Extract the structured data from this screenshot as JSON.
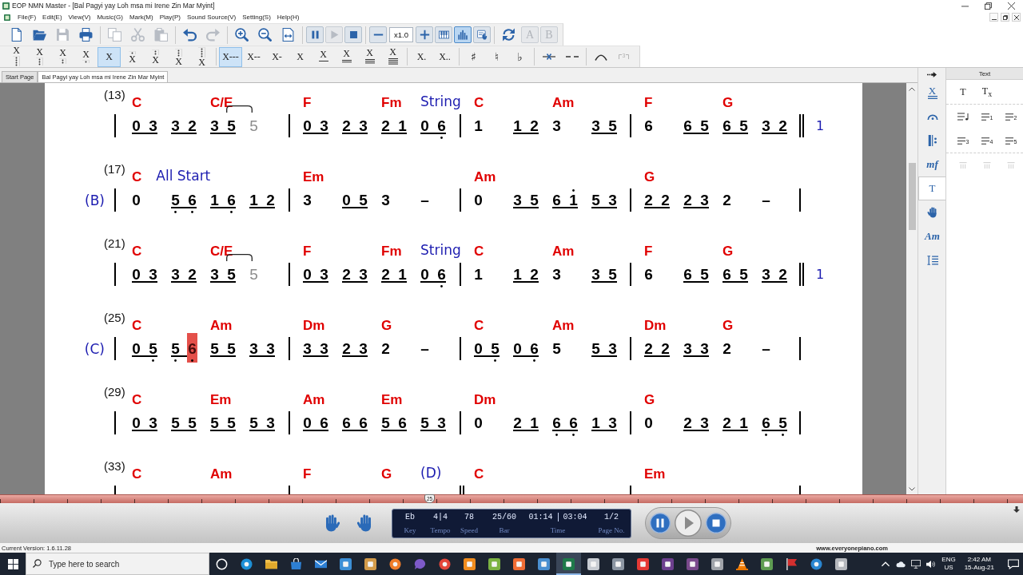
{
  "window": {
    "title": "EOP NMN Master - [Bal Pagyi yay Loh msa mi Irene Zin Mar Myint]"
  },
  "menu": [
    "File(F)",
    "Edit(E)",
    "View(V)",
    "Music(G)",
    "Mark(M)",
    "Play(P)",
    "Sound Source(V)",
    "Setting(S)",
    "Help(H)"
  ],
  "toolbar": {
    "groups": [
      [
        {
          "kind": "new",
          "disabled": false,
          "selected": false
        },
        {
          "kind": "open",
          "disabled": false,
          "selected": false
        },
        {
          "kind": "save",
          "disabled": true,
          "selected": false
        },
        {
          "kind": "print",
          "disabled": false,
          "selected": false
        }
      ],
      [
        {
          "kind": "copy",
          "disabled": true,
          "selected": false
        },
        {
          "kind": "cut",
          "disabled": true,
          "selected": false
        },
        {
          "kind": "paste",
          "disabled": true,
          "selected": false
        }
      ],
      [
        {
          "kind": "undo",
          "disabled": false,
          "selected": false
        },
        {
          "kind": "redo",
          "disabled": true,
          "selected": false
        }
      ],
      [
        {
          "kind": "zoom-in",
          "disabled": false,
          "selected": false
        },
        {
          "kind": "zoom-out",
          "disabled": false,
          "selected": false
        },
        {
          "kind": "fit",
          "disabled": false,
          "selected": false
        }
      ],
      [
        {
          "kind": "pause",
          "disabled": false,
          "selected": false
        },
        {
          "kind": "play",
          "disabled": true,
          "selected": false
        },
        {
          "kind": "stop",
          "disabled": false,
          "selected": false
        }
      ],
      [
        {
          "kind": "minus",
          "disabled": false,
          "selected": false
        },
        {
          "kind": "field",
          "value": "x1.0",
          "disabled": false,
          "selected": false
        },
        {
          "kind": "plus",
          "disabled": false,
          "selected": false
        },
        {
          "kind": "keys",
          "disabled": false,
          "selected": false
        },
        {
          "kind": "bars",
          "disabled": false,
          "selected": true
        },
        {
          "kind": "hand-score",
          "disabled": false,
          "selected": false
        }
      ],
      [
        {
          "kind": "swap",
          "disabled": false,
          "selected": false
        },
        {
          "kind": "letter",
          "label": "A",
          "disabled": true,
          "selected": false
        },
        {
          "kind": "letter",
          "label": "B",
          "disabled": true,
          "selected": false
        }
      ]
    ]
  },
  "notation_bar": {
    "groups": [
      [
        {
          "kind": "low4",
          "label": "X",
          "selected": false,
          "disabled": false
        },
        {
          "kind": "low3",
          "label": "X",
          "selected": false,
          "disabled": false
        },
        {
          "kind": "low2",
          "label": "X",
          "selected": false,
          "disabled": false
        },
        {
          "kind": "low1",
          "label": "X",
          "selected": false,
          "disabled": false
        },
        {
          "kind": "middle",
          "label": "X",
          "selected": true,
          "disabled": false
        },
        {
          "kind": "high1",
          "label": "X",
          "selected": false,
          "disabled": false
        },
        {
          "kind": "high2",
          "label": "X",
          "selected": false,
          "disabled": false
        },
        {
          "kind": "high3",
          "label": "X",
          "selected": false,
          "disabled": false
        },
        {
          "kind": "high4",
          "label": "X",
          "selected": false,
          "disabled": false
        }
      ],
      [
        {
          "kind": "duration",
          "label": "X---",
          "selected": true,
          "disabled": false
        },
        {
          "kind": "duration",
          "label": "X--",
          "selected": false,
          "disabled": false
        },
        {
          "kind": "duration",
          "label": "X-",
          "selected": false,
          "disabled": false
        },
        {
          "kind": "duration",
          "label": "X",
          "selected": false,
          "disabled": false
        },
        {
          "kind": "eighth",
          "label": "X",
          "selected": false,
          "disabled": false
        },
        {
          "kind": "sixteenth",
          "label": "X",
          "selected": false,
          "disabled": false
        },
        {
          "kind": "thirty-second",
          "label": "X",
          "selected": false,
          "disabled": false
        },
        {
          "kind": "sixty-fourth",
          "label": "X",
          "selected": false,
          "disabled": false
        }
      ],
      [
        {
          "kind": "plain",
          "label": "X.",
          "selected": false,
          "disabled": false
        },
        {
          "kind": "plain",
          "label": "X..",
          "selected": false,
          "disabled": false
        }
      ],
      [
        {
          "kind": "accidental",
          "label": "♯",
          "selected": false,
          "disabled": false
        },
        {
          "kind": "accidental",
          "label": "♮",
          "selected": false,
          "disabled": false
        },
        {
          "kind": "accidental",
          "label": "♭",
          "selected": false,
          "disabled": false
        }
      ],
      [
        {
          "kind": "tie-x",
          "selected": false,
          "disabled": false
        },
        {
          "kind": "dash",
          "selected": false,
          "disabled": false
        }
      ],
      [
        {
          "kind": "slur",
          "selected": false,
          "disabled": false
        },
        {
          "kind": "triplet",
          "label": "3",
          "selected": false,
          "disabled": true
        }
      ]
    ]
  },
  "tabs": [
    {
      "label": "Start Page",
      "selected": false
    },
    {
      "label": "Bal Pagyi yay Loh msa mi Irene Zin Mar Myint",
      "selected": true
    }
  ],
  "score": {
    "rows": [
      {
        "number": "(13)",
        "ending": "1",
        "measures": [
          {
            "double_bar": false,
            "chords": [
              "C",
              "C/E"
            ],
            "beats": [
              {
                "beamed": true,
                "notes": [
                  {
                    "symbol": "0"
                  },
                  {
                    "symbol": "3"
                  }
                ]
              },
              {
                "beamed": true,
                "notes": [
                  {
                    "symbol": "3"
                  },
                  {
                    "symbol": "2"
                  }
                ]
              },
              {
                "beamed": true,
                "notes": [
                  {
                    "symbol": "3"
                  },
                  {
                    "symbol": "5"
                  }
                ]
              },
              {
                "notes": [
                  {
                    "symbol": "5",
                    "tied": true
                  }
                ]
              }
            ]
          },
          {
            "double_bar": false,
            "chords": [
              "F",
              "Fm"
            ],
            "annotation": {
              "kind": "end",
              "text": "String"
            },
            "beats": [
              {
                "beamed": true,
                "notes": [
                  {
                    "symbol": "0"
                  },
                  {
                    "symbol": "3"
                  }
                ]
              },
              {
                "beamed": true,
                "notes": [
                  {
                    "symbol": "2"
                  },
                  {
                    "symbol": "3"
                  }
                ]
              },
              {
                "beamed": true,
                "notes": [
                  {
                    "symbol": "2"
                  },
                  {
                    "symbol": "1"
                  }
                ]
              },
              {
                "beamed": true,
                "notes": [
                  {
                    "symbol": "0"
                  },
                  {
                    "symbol": "6",
                    "low": true
                  }
                ]
              }
            ]
          },
          {
            "double_bar": false,
            "chords": [
              "C",
              "Am"
            ],
            "beats": [
              {
                "notes": [
                  {
                    "symbol": "1"
                  }
                ]
              },
              {
                "beamed": true,
                "notes": [
                  {
                    "symbol": "1"
                  },
                  {
                    "symbol": "2"
                  }
                ]
              },
              {
                "notes": [
                  {
                    "symbol": "3"
                  }
                ]
              },
              {
                "beamed": true,
                "notes": [
                  {
                    "symbol": "3"
                  },
                  {
                    "symbol": "5"
                  }
                ]
              }
            ]
          },
          {
            "double_bar": true,
            "chords": [
              "F",
              "G"
            ],
            "beats": [
              {
                "notes": [
                  {
                    "symbol": "6"
                  }
                ]
              },
              {
                "beamed": true,
                "notes": [
                  {
                    "symbol": "6"
                  },
                  {
                    "symbol": "5"
                  }
                ]
              },
              {
                "beamed": true,
                "notes": [
                  {
                    "symbol": "6"
                  },
                  {
                    "symbol": "5"
                  }
                ]
              },
              {
                "beamed": true,
                "notes": [
                  {
                    "symbol": "3"
                  },
                  {
                    "symbol": "2"
                  }
                ]
              }
            ]
          }
        ]
      },
      {
        "number": "(17)",
        "section": "(B)",
        "measures": [
          {
            "double_bar": false,
            "chords": [
              "C"
            ],
            "annotation": {
              "kind": "inline",
              "text": "All Start"
            },
            "beats": [
              {
                "notes": [
                  {
                    "symbol": "0"
                  }
                ]
              },
              {
                "beamed": true,
                "notes": [
                  {
                    "symbol": "5",
                    "low": true
                  },
                  {
                    "symbol": "6",
                    "low": true
                  }
                ]
              },
              {
                "beamed": true,
                "notes": [
                  {
                    "symbol": "1"
                  },
                  {
                    "symbol": "6",
                    "low": true
                  }
                ]
              },
              {
                "beamed": true,
                "notes": [
                  {
                    "symbol": "1"
                  },
                  {
                    "symbol": "2"
                  }
                ]
              }
            ]
          },
          {
            "double_bar": false,
            "chords": [
              "Em"
            ],
            "beats": [
              {
                "notes": [
                  {
                    "symbol": "3"
                  }
                ]
              },
              {
                "beamed": true,
                "notes": [
                  {
                    "symbol": "0"
                  },
                  {
                    "symbol": "5"
                  }
                ]
              },
              {
                "notes": [
                  {
                    "symbol": "3"
                  }
                ]
              },
              {
                "notes": [
                  {
                    "symbol": "–"
                  }
                ]
              }
            ]
          },
          {
            "double_bar": false,
            "chords": [
              "Am"
            ],
            "beats": [
              {
                "notes": [
                  {
                    "symbol": "0"
                  }
                ]
              },
              {
                "beamed": true,
                "notes": [
                  {
                    "symbol": "3"
                  },
                  {
                    "symbol": "5"
                  }
                ]
              },
              {
                "beamed": true,
                "notes": [
                  {
                    "symbol": "6"
                  },
                  {
                    "symbol": "1",
                    "high": true
                  }
                ]
              },
              {
                "beamed": true,
                "notes": [
                  {
                    "symbol": "5"
                  },
                  {
                    "symbol": "3"
                  }
                ]
              }
            ]
          },
          {
            "double_bar": false,
            "chords": [
              "G"
            ],
            "beats": [
              {
                "beamed": true,
                "notes": [
                  {
                    "symbol": "2"
                  },
                  {
                    "symbol": "2"
                  }
                ]
              },
              {
                "beamed": true,
                "notes": [
                  {
                    "symbol": "2"
                  },
                  {
                    "symbol": "3"
                  }
                ]
              },
              {
                "notes": [
                  {
                    "symbol": "2"
                  }
                ]
              },
              {
                "notes": [
                  {
                    "symbol": "–"
                  }
                ]
              }
            ]
          }
        ]
      },
      {
        "number": "(21)",
        "ending": "1",
        "measures": [
          {
            "double_bar": false,
            "chords": [
              "C",
              "C/E"
            ],
            "beats": [
              {
                "beamed": true,
                "notes": [
                  {
                    "symbol": "0"
                  },
                  {
                    "symbol": "3"
                  }
                ]
              },
              {
                "beamed": true,
                "notes": [
                  {
                    "symbol": "3"
                  },
                  {
                    "symbol": "2"
                  }
                ]
              },
              {
                "beamed": true,
                "notes": [
                  {
                    "symbol": "3"
                  },
                  {
                    "symbol": "5"
                  }
                ]
              },
              {
                "notes": [
                  {
                    "symbol": "5",
                    "tied": true
                  }
                ]
              }
            ]
          },
          {
            "double_bar": false,
            "chords": [
              "F",
              "Fm"
            ],
            "annotation": {
              "kind": "end",
              "text": "String"
            },
            "beats": [
              {
                "beamed": true,
                "notes": [
                  {
                    "symbol": "0"
                  },
                  {
                    "symbol": "3"
                  }
                ]
              },
              {
                "beamed": true,
                "notes": [
                  {
                    "symbol": "2"
                  },
                  {
                    "symbol": "3"
                  }
                ]
              },
              {
                "beamed": true,
                "notes": [
                  {
                    "symbol": "2"
                  },
                  {
                    "symbol": "1"
                  }
                ]
              },
              {
                "beamed": true,
                "notes": [
                  {
                    "symbol": "0"
                  },
                  {
                    "symbol": "6",
                    "low": true
                  }
                ]
              }
            ]
          },
          {
            "double_bar": false,
            "chords": [
              "C",
              "Am"
            ],
            "beats": [
              {
                "notes": [
                  {
                    "symbol": "1"
                  }
                ]
              },
              {
                "beamed": true,
                "notes": [
                  {
                    "symbol": "1"
                  },
                  {
                    "symbol": "2"
                  }
                ]
              },
              {
                "notes": [
                  {
                    "symbol": "3"
                  }
                ]
              },
              {
                "beamed": true,
                "notes": [
                  {
                    "symbol": "3"
                  },
                  {
                    "symbol": "5"
                  }
                ]
              }
            ]
          },
          {
            "double_bar": true,
            "chords": [
              "F",
              "G"
            ],
            "beats": [
              {
                "notes": [
                  {
                    "symbol": "6"
                  }
                ]
              },
              {
                "beamed": true,
                "notes": [
                  {
                    "symbol": "6"
                  },
                  {
                    "symbol": "5"
                  }
                ]
              },
              {
                "beamed": true,
                "notes": [
                  {
                    "symbol": "6"
                  },
                  {
                    "symbol": "5"
                  }
                ]
              },
              {
                "beamed": true,
                "notes": [
                  {
                    "symbol": "3"
                  },
                  {
                    "symbol": "2"
                  }
                ]
              }
            ]
          }
        ]
      },
      {
        "number": "(25)",
        "section": "(C)",
        "measures": [
          {
            "double_bar": false,
            "chords": [
              "C",
              "Am"
            ],
            "beats": [
              {
                "beamed": true,
                "notes": [
                  {
                    "symbol": "0"
                  },
                  {
                    "symbol": "5",
                    "low": true
                  }
                ]
              },
              {
                "beamed": true,
                "notes": [
                  {
                    "symbol": "5",
                    "low": true
                  },
                  {
                    "symbol": "6",
                    "low": true,
                    "current": true
                  }
                ]
              },
              {
                "beamed": true,
                "notes": [
                  {
                    "symbol": "5"
                  },
                  {
                    "symbol": "5"
                  }
                ]
              },
              {
                "beamed": true,
                "notes": [
                  {
                    "symbol": "3"
                  },
                  {
                    "symbol": "3"
                  }
                ]
              }
            ]
          },
          {
            "double_bar": false,
            "chords": [
              "Dm",
              "G"
            ],
            "beats": [
              {
                "beamed": true,
                "notes": [
                  {
                    "symbol": "3"
                  },
                  {
                    "symbol": "3"
                  }
                ]
              },
              {
                "beamed": true,
                "notes": [
                  {
                    "symbol": "2"
                  },
                  {
                    "symbol": "3"
                  }
                ]
              },
              {
                "notes": [
                  {
                    "symbol": "2"
                  }
                ]
              },
              {
                "notes": [
                  {
                    "symbol": "–"
                  }
                ]
              }
            ]
          },
          {
            "double_bar": false,
            "chords": [
              "C",
              "Am"
            ],
            "beats": [
              {
                "beamed": true,
                "notes": [
                  {
                    "symbol": "0"
                  },
                  {
                    "symbol": "5",
                    "low": true
                  }
                ]
              },
              {
                "beamed": true,
                "notes": [
                  {
                    "symbol": "0"
                  },
                  {
                    "symbol": "6",
                    "low": true
                  }
                ]
              },
              {
                "notes": [
                  {
                    "symbol": "5"
                  }
                ]
              },
              {
                "beamed": true,
                "notes": [
                  {
                    "symbol": "5"
                  },
                  {
                    "symbol": "3"
                  }
                ]
              }
            ]
          },
          {
            "double_bar": false,
            "chords": [
              "Dm",
              "G"
            ],
            "beats": [
              {
                "beamed": true,
                "notes": [
                  {
                    "symbol": "2"
                  },
                  {
                    "symbol": "2"
                  }
                ]
              },
              {
                "beamed": true,
                "notes": [
                  {
                    "symbol": "3"
                  },
                  {
                    "symbol": "3"
                  }
                ]
              },
              {
                "notes": [
                  {
                    "symbol": "2"
                  }
                ]
              },
              {
                "notes": [
                  {
                    "symbol": "–"
                  }
                ]
              }
            ]
          }
        ]
      },
      {
        "number": "(29)",
        "measures": [
          {
            "double_bar": false,
            "chords": [
              "C",
              "Em"
            ],
            "beats": [
              {
                "beamed": true,
                "notes": [
                  {
                    "symbol": "0"
                  },
                  {
                    "symbol": "3"
                  }
                ]
              },
              {
                "beamed": true,
                "notes": [
                  {
                    "symbol": "5"
                  },
                  {
                    "symbol": "5"
                  }
                ]
              },
              {
                "beamed": true,
                "notes": [
                  {
                    "symbol": "5"
                  },
                  {
                    "symbol": "5"
                  }
                ]
              },
              {
                "beamed": true,
                "notes": [
                  {
                    "symbol": "5"
                  },
                  {
                    "symbol": "3"
                  }
                ]
              }
            ]
          },
          {
            "double_bar": false,
            "chords": [
              "Am",
              "Em"
            ],
            "beats": [
              {
                "beamed": true,
                "notes": [
                  {
                    "symbol": "0"
                  },
                  {
                    "symbol": "6"
                  }
                ]
              },
              {
                "beamed": true,
                "notes": [
                  {
                    "symbol": "6"
                  },
                  {
                    "symbol": "6"
                  }
                ]
              },
              {
                "beamed": true,
                "notes": [
                  {
                    "symbol": "5"
                  },
                  {
                    "symbol": "6"
                  }
                ]
              },
              {
                "beamed": true,
                "notes": [
                  {
                    "symbol": "5"
                  },
                  {
                    "symbol": "3"
                  }
                ]
              }
            ]
          },
          {
            "double_bar": false,
            "chords": [
              "Dm"
            ],
            "beats": [
              {
                "notes": [
                  {
                    "symbol": "0"
                  }
                ]
              },
              {
                "beamed": true,
                "notes": [
                  {
                    "symbol": "2"
                  },
                  {
                    "symbol": "1"
                  }
                ]
              },
              {
                "beamed": true,
                "notes": [
                  {
                    "symbol": "6",
                    "low": true
                  },
                  {
                    "symbol": "6",
                    "low": true
                  }
                ]
              },
              {
                "beamed": true,
                "notes": [
                  {
                    "symbol": "1"
                  },
                  {
                    "symbol": "3"
                  }
                ]
              }
            ]
          },
          {
            "double_bar": false,
            "chords": [
              "G"
            ],
            "beats": [
              {
                "notes": [
                  {
                    "symbol": "0"
                  }
                ]
              },
              {
                "beamed": true,
                "notes": [
                  {
                    "symbol": "2"
                  },
                  {
                    "symbol": "3"
                  }
                ]
              },
              {
                "beamed": true,
                "notes": [
                  {
                    "symbol": "2"
                  },
                  {
                    "symbol": "1"
                  }
                ]
              },
              {
                "beamed": true,
                "notes": [
                  {
                    "symbol": "6",
                    "low": true
                  },
                  {
                    "symbol": "5",
                    "low": true
                  }
                ]
              }
            ]
          }
        ]
      },
      {
        "number": "(33)",
        "measures": [
          {
            "double_bar": false,
            "chords": [
              "C",
              "Am"
            ]
          },
          {
            "double_bar": true,
            "chords": [
              "F",
              "G"
            ],
            "annotation": {
              "kind": "end",
              "text": "(D)"
            }
          },
          {
            "double_bar": false,
            "chords": [
              "C"
            ]
          },
          {
            "double_bar": false,
            "chords": [
              "Em"
            ]
          }
        ]
      }
    ]
  },
  "side_tabs": [
    {
      "kind": "x-line",
      "label": "X",
      "selected": false
    },
    {
      "kind": "fermata",
      "selected": false
    },
    {
      "kind": "repeat",
      "selected": false
    },
    {
      "kind": "dynamic",
      "label": "mf",
      "selected": false
    },
    {
      "kind": "text",
      "label": "T",
      "selected": true
    },
    {
      "kind": "hand",
      "selected": false
    },
    {
      "kind": "chord",
      "label": "Am",
      "selected": false
    },
    {
      "kind": "spacing",
      "selected": false
    }
  ],
  "panel": {
    "title": "Text",
    "sections": [
      [
        {
          "kind": "text",
          "label": "T",
          "disabled": false
        },
        {
          "kind": "text",
          "label": "T$_{x}$",
          "disabled": false
        }
      ],
      [
        {
          "kind": "lyric-note",
          "disabled": false
        },
        {
          "kind": "lyric",
          "label": "1",
          "disabled": false
        },
        {
          "kind": "lyric",
          "label": "2",
          "disabled": false
        },
        {
          "kind": "lyric",
          "label": "3",
          "disabled": false
        },
        {
          "kind": "lyric",
          "label": "4",
          "disabled": false
        },
        {
          "kind": "lyric",
          "label": "5",
          "disabled": false
        }
      ],
      [
        {
          "kind": "align",
          "disabled": true
        },
        {
          "kind": "align",
          "disabled": true
        },
        {
          "kind": "align",
          "disabled": true
        }
      ]
    ]
  },
  "progress": {
    "level": 0.42,
    "label": "25"
  },
  "player": {
    "display": [
      {
        "value": "Eb",
        "label": "Key"
      },
      {
        "value": "4|4",
        "label": "Tempo"
      },
      {
        "value": "78",
        "label": "Speed"
      },
      {
        "value": "25/60",
        "label": "Bar"
      },
      {
        "value": "01:14",
        "total": "03:04",
        "label": "Time"
      },
      {
        "value": "1/2",
        "label": "Page No."
      }
    ]
  },
  "status_bar": {
    "version": "Current Version: 1.6.11.28",
    "website": "www.everyonepiano.com"
  },
  "taskbar": {
    "search_placeholder": "Type here to search",
    "apps": [
      {
        "kind": "ring",
        "color": "#ffffff",
        "selected": false
      },
      {
        "kind": "globe",
        "color": "#1e90d6",
        "selected": false
      },
      {
        "kind": "folder",
        "color": "#f2c14e",
        "selected": false
      },
      {
        "kind": "bag",
        "color": "#2d7fd3",
        "selected": false
      },
      {
        "kind": "envelope",
        "color": "#2d7fd3",
        "selected": false
      },
      {
        "kind": "tile",
        "color": "#3c8fd6",
        "selected": false
      },
      {
        "kind": "tile",
        "color": "#d39b4a",
        "selected": false
      },
      {
        "kind": "globe",
        "color": "#f07d2a",
        "selected": false
      },
      {
        "kind": "chat",
        "color": "#7d5ac8",
        "selected": false
      },
      {
        "kind": "globe",
        "color": "#e4463b",
        "selected": false
      },
      {
        "kind": "tile",
        "color": "#f08c1e",
        "selected": false
      },
      {
        "kind": "tile",
        "color": "#7cb342",
        "selected": false
      },
      {
        "kind": "tile",
        "color": "#ef6c35",
        "selected": false
      },
      {
        "kind": "tile",
        "color": "#4a8fd0",
        "selected": false
      },
      {
        "kind": "tile",
        "color": "#1f7a4a",
        "selected": true
      },
      {
        "kind": "tile",
        "color": "#c8ccd2",
        "selected": false
      },
      {
        "kind": "tile",
        "color": "#8c96a3",
        "selected": false
      },
      {
        "kind": "tile",
        "color": "#e53935",
        "selected": false
      },
      {
        "kind": "tile",
        "color": "#6d3f8f",
        "selected": false
      },
      {
        "kind": "tile",
        "color": "#7a4a8c",
        "selected": false
      },
      {
        "kind": "tile",
        "color": "#a0a4aa",
        "selected": false
      },
      {
        "kind": "cone",
        "color": "#f57c00",
        "selected": false
      },
      {
        "kind": "tile",
        "color": "#5e9c52",
        "selected": false
      },
      {
        "kind": "flag",
        "color": "#d32f2f",
        "selected": false
      },
      {
        "kind": "globe",
        "color": "#2a86d0",
        "selected": false
      },
      {
        "kind": "tile",
        "color": "#b5b8bd",
        "selected": false
      }
    ],
    "tray": {
      "language": "ENG",
      "region": "US",
      "time": "2:42 AM",
      "date": "15-Aug-21"
    }
  }
}
